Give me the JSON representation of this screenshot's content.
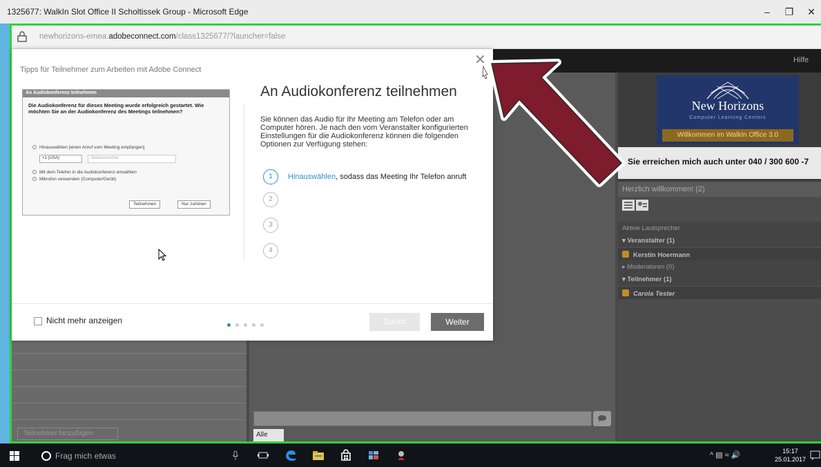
{
  "window": {
    "title": "1325677: WalkIn Slot Office II Scholtissek Group - Microsoft Edge",
    "url_prefix": "newhorizons-emea.",
    "url_domain": "adobeconnect.com",
    "url_path": "/class1325677/?launcher=false",
    "minimize": "–",
    "restore": "❐",
    "close": "✕"
  },
  "app": {
    "help_label": "Hilfe",
    "banner_title": "New Horizons",
    "banner_sub": "Computer Learning Centers",
    "banner_welcome": "Willkommen im WalkIn Office 3.0",
    "reach_text": "Sie erreichen mich auch unter 040 / 300 600 -7",
    "attendees": {
      "header": "Herzlich willkommen!  (2)",
      "active_speakers": "Aktive Lautsprecher",
      "hosts": "Veranstalter (1)",
      "host_name": "Kerstin Hoermann",
      "presenters": "Moderatoren (0)",
      "participants": "Teilnehmer (1)",
      "participant_name": "Carola Tester"
    },
    "left_button": "Teilnehmer hinzufügen",
    "chat_tab": "Alle"
  },
  "modal": {
    "tips_title": "Tipps für Teilnehmer zum Arbeiten mit Adobe Connect",
    "close_icon": "✕",
    "heading": "An Audiokonferenz teilnehmen",
    "body": "Sie können das Audio für Ihr Meeting am Telefon oder am Computer hören. Je nach den vom Veranstalter konfigurierten Einstellungen für die Audiokonferenz können die folgenden Optionen zur Verfügung stehen:",
    "steps": [
      "1",
      "2",
      "3",
      "4"
    ],
    "step1_link": "Hinauswählen",
    "step1_text": ", sodass das Meeting Ihr Telefon anruft",
    "dont_show": "Nicht mehr anzeigen",
    "back_label": "Zurück",
    "next_label": "Weiter",
    "preview": {
      "title": "An Audiokonferenz teilnehmen",
      "text": "Die Audiokonferenz für dieses Meeting wurde erfolgreich gestartet. Wie möchten Sie an der Audiokonferenz des Meetings teilnehmen?",
      "opt1": "Hinauswählen [einen Anruf vom Meeting empfangen]",
      "country": "+1 (USA)",
      "phone_placeholder": "Telefonnummer",
      "opt2": "Mit dem Telefon in die Audiokonferenz einwählen",
      "opt3": "Mikrofon verwenden (Computer/Gerät)",
      "join_btn": "Teilnehmen",
      "listen_btn": "Nur zuhören"
    }
  },
  "taskbar": {
    "search_placeholder": "Frag mich etwas",
    "time": "15:17",
    "date": "25.01.2017"
  },
  "colors": {
    "accent": "#2a8fc9",
    "frame_green": "#2bd43b",
    "arrow_red": "#7e1b2c"
  }
}
